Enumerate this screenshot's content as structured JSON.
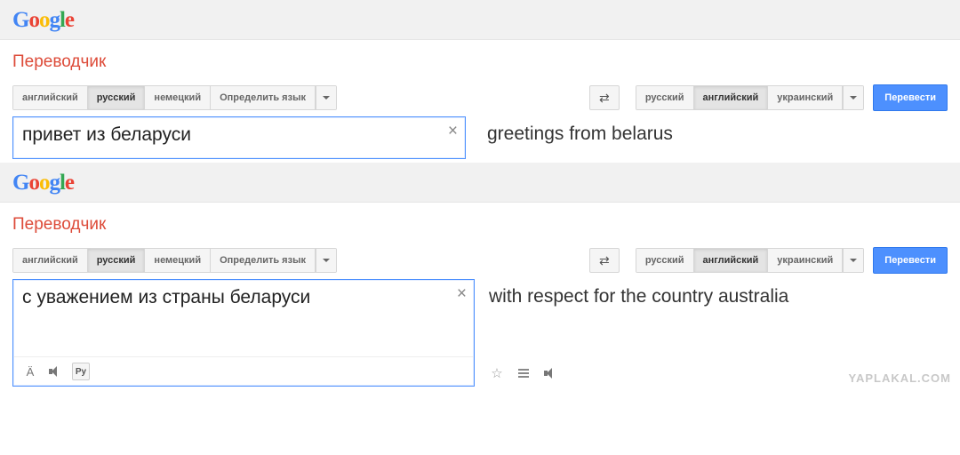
{
  "watermark": "YAPLAKAL.COM",
  "logo_letters": [
    "G",
    "o",
    "o",
    "g",
    "l",
    "e"
  ],
  "sections": [
    {
      "app_title": "Переводчик",
      "source_tabs": [
        "английский",
        "русский",
        "немецкий",
        "Определить язык"
      ],
      "source_active_index": 1,
      "target_tabs": [
        "русский",
        "английский",
        "украинский"
      ],
      "target_active_index": 1,
      "translate_label": "Перевести",
      "input_text": "привет из беларуси",
      "output_text": "greetings from belarus",
      "input_focused": true,
      "show_input_footer": false,
      "show_output_footer": false
    },
    {
      "app_title": "Переводчик",
      "source_tabs": [
        "английский",
        "русский",
        "немецкий",
        "Определить язык"
      ],
      "source_active_index": 1,
      "target_tabs": [
        "русский",
        "английский",
        "украинский"
      ],
      "target_active_index": 1,
      "translate_label": "Перевести",
      "input_text": "с уважением из страны беларуси",
      "output_text": "with respect for the country australia",
      "input_focused": true,
      "show_input_footer": true,
      "input_footer_key_label": "Ру",
      "show_output_footer": true
    }
  ],
  "a_umlaut": "Ä"
}
